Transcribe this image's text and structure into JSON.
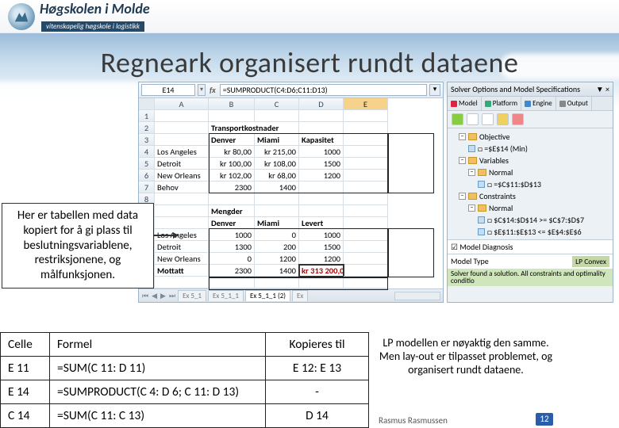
{
  "logo": {
    "line1": "Høgskolen i Molde",
    "line2": "vitenskapelig høgskole i logistikk"
  },
  "slide_title": "Regneark organisert rundt dataene",
  "callout": "Her er tabellen med data kopiert for å gi plass til beslutningsvariablene, restriksjonene, og målfunksjonen.",
  "spreadsheet": {
    "namebox": "E14",
    "formula": "=SUMPRODUCT(C4:D6;C11:D13)",
    "cols": [
      "A",
      "B",
      "C",
      "D",
      "E"
    ],
    "rows": {
      "r1": [
        "",
        "",
        "",
        "",
        ""
      ],
      "r2": [
        "",
        "",
        "Transportkostnader",
        "",
        ""
      ],
      "r3": [
        "",
        "",
        "Denver",
        "Miami",
        "Kapasitet"
      ],
      "r4": [
        "",
        "Los Angeles",
        "kr  80,00",
        "kr 215,00",
        "1000"
      ],
      "r5": [
        "",
        "Detroit",
        "kr 100,00",
        "kr 108,00",
        "1500"
      ],
      "r6": [
        "",
        "New Orleans",
        "kr 102,00",
        "kr  68,00",
        "1200"
      ],
      "r7": [
        "",
        "Behov",
        "2300",
        "1400",
        ""
      ],
      "r8": [
        "",
        "",
        "",
        "",
        ""
      ],
      "r9": [
        "",
        "",
        "Mengder",
        "",
        ""
      ],
      "r10": [
        "",
        "",
        "Denver",
        "Miami",
        "Levert"
      ],
      "r11": [
        "",
        "Los Angeles",
        "1000",
        "0",
        "1000"
      ],
      "r12": [
        "",
        "Detroit",
        "1300",
        "200",
        "1500"
      ],
      "r13": [
        "",
        "New Orleans",
        "0",
        "1200",
        "1200"
      ],
      "r14": [
        "",
        "Mottatt",
        "2300",
        "1400",
        "kr 313 200,00"
      ],
      "r15": [
        "",
        "",
        "",
        "",
        ""
      ]
    },
    "sheet_tabs": [
      "Ex 5_1",
      "Ex 5_1_1",
      "Ex 5_1_1 (2)",
      "Ex"
    ]
  },
  "solver": {
    "title": "Solver Options and Model Specifications",
    "tabs": [
      "Model",
      "Platform",
      "Engine",
      "Output"
    ],
    "tree": {
      "objective_label": "Objective",
      "objective_item": "□ =$E$14 (Min)",
      "variables_label": "Variables",
      "normal_label": "Normal",
      "variables_item": "□ =$C$11:$D$13",
      "constraints_label": "Constraints",
      "constraints_item1": "□ $C$14:$D$14 >= $C$7:$D$7",
      "constraints_item2": "□ $E$11:$E$13 <= $E$4:$E$6"
    },
    "diagnosis_label": "Model Diagnosis",
    "model_type_label": "Model Type",
    "model_type_value": "LP Convex",
    "status_msg": "Solver found a solution. All constraints and optimality conditio"
  },
  "bottom_table": {
    "headers": [
      "Celle",
      "Formel",
      "Kopieres til"
    ],
    "rows": [
      [
        "E 11",
        "=SUM(C 11: D 11)",
        "E 12: E 13"
      ],
      [
        "E 14",
        "=SUMPRODUCT(C 4: D 6; C 11: D 13)",
        "-"
      ],
      [
        "C 14",
        "=SUM(C 11: C 13)",
        "D 14"
      ]
    ]
  },
  "note": "LP modellen er nøyaktig den samme.\nMen lay-out er tilpasset problemet, og organisert rundt dataene.",
  "footer": {
    "author": "Rasmus Rasmussen",
    "page": "12"
  }
}
